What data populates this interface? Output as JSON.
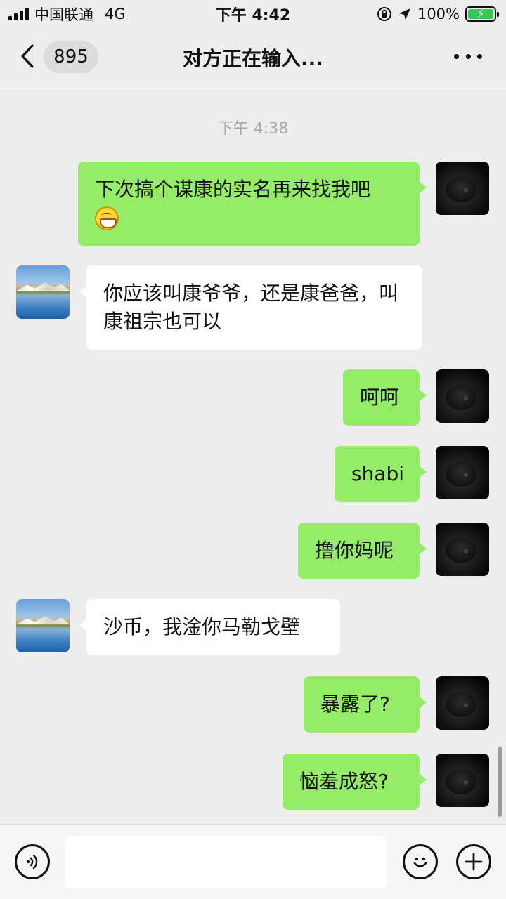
{
  "status_bar": {
    "carrier": "中国联通",
    "network": "4G",
    "time": "下午 4:42",
    "battery": "100%"
  },
  "nav": {
    "unread_count": "895",
    "title": "对方正在输入..."
  },
  "chat": {
    "timestamp": "下午 4:38",
    "messages": [
      {
        "sender": "me",
        "text": "下次搞个谋康的实名再来找我吧",
        "emoji": "grinning-face-icon"
      },
      {
        "sender": "them",
        "text": "你应该叫康爷爷，还是康爸爸，叫康祖宗也可以"
      },
      {
        "sender": "me",
        "text": "呵呵"
      },
      {
        "sender": "me",
        "text": "shabi"
      },
      {
        "sender": "me",
        "text": "撸你妈呢"
      },
      {
        "sender": "them",
        "text": "沙币，我淦你马勒戈壁"
      },
      {
        "sender": "me",
        "text": "暴露了?"
      },
      {
        "sender": "me",
        "text": "恼羞成怒?"
      }
    ]
  },
  "input": {
    "placeholder": "",
    "value": ""
  },
  "colors": {
    "my_bubble": "#95ec69",
    "their_bubble": "#ffffff",
    "background": "#ededed"
  }
}
